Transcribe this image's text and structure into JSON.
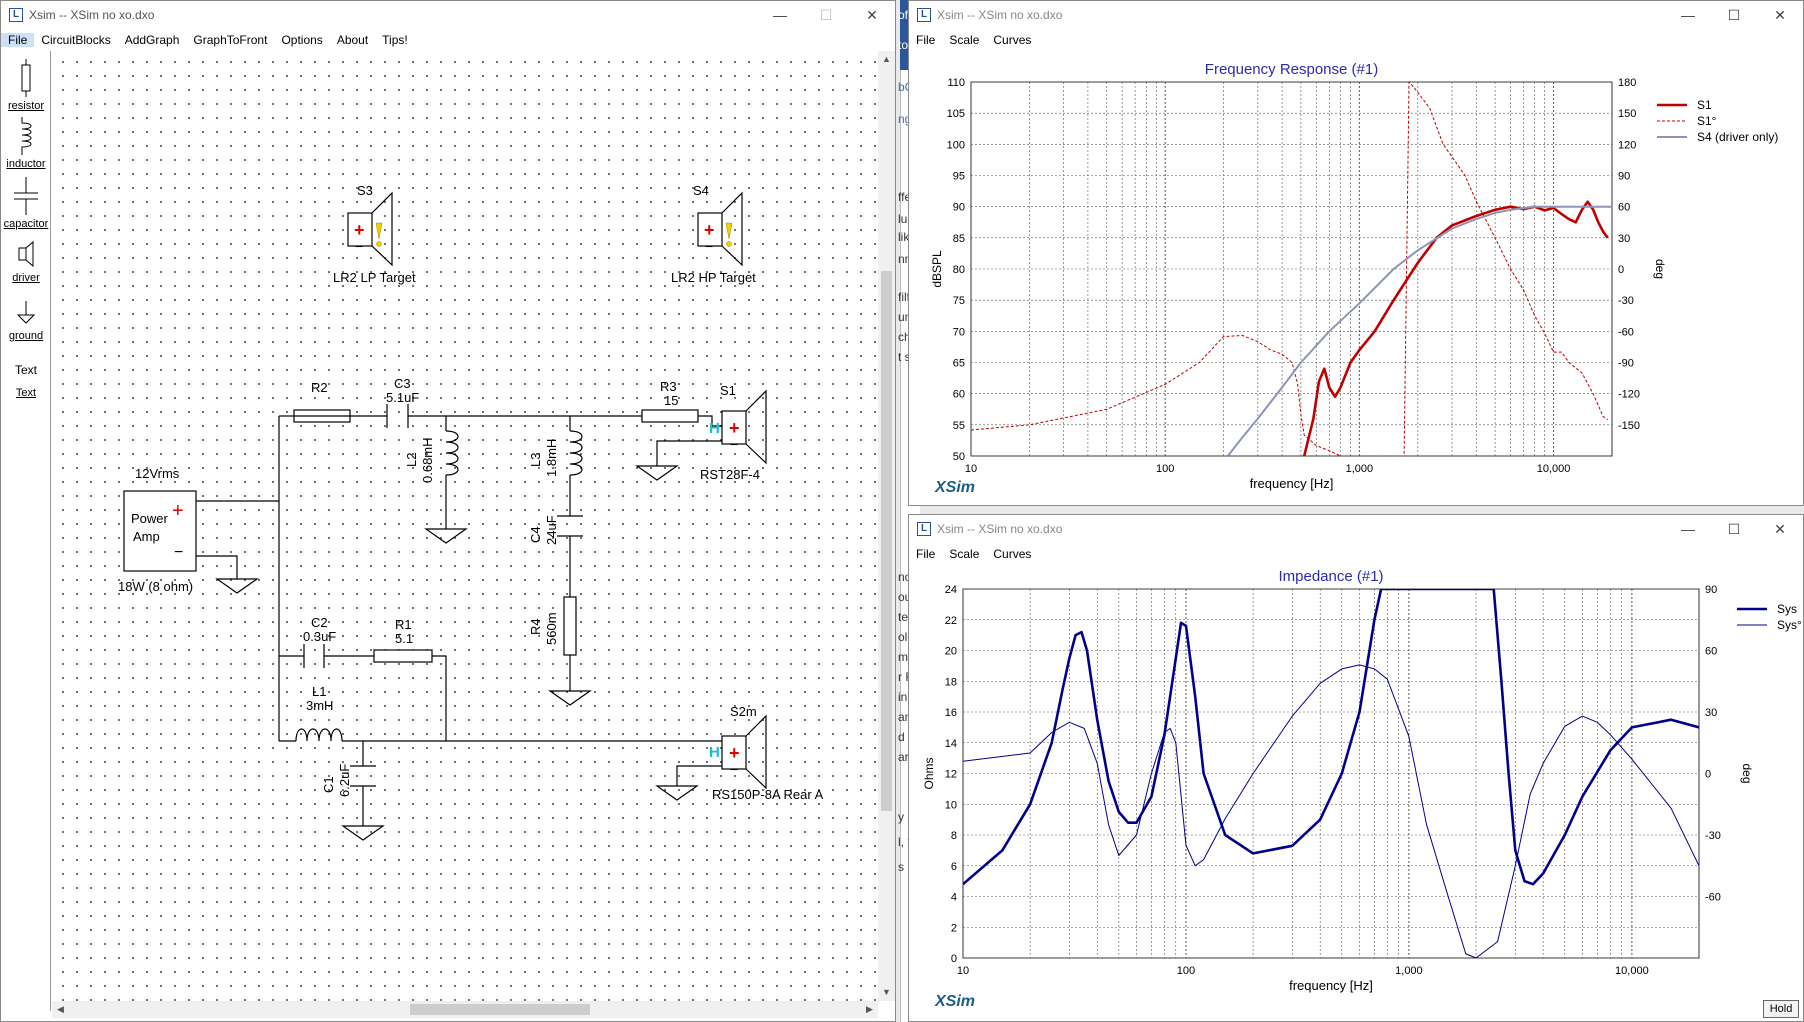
{
  "circuit_window": {
    "title": "Xsim -- XSim no xo.dxo",
    "menu": [
      "File",
      "CircuitBlocks",
      "AddGraph",
      "GraphToFront",
      "Options",
      "About",
      "Tips!"
    ],
    "toolbar": [
      {
        "label": "resistor",
        "icon": "resistor-icon"
      },
      {
        "label": "inductor",
        "icon": "inductor-icon"
      },
      {
        "label": "capacitor",
        "icon": "capacitor-icon"
      },
      {
        "label": "driver",
        "icon": "driver-icon"
      },
      {
        "label": "ground",
        "icon": "ground-icon"
      },
      {
        "label": "Text",
        "icon": "text-icon"
      },
      {
        "label": "Text",
        "icon": "text-label"
      }
    ],
    "components": {
      "s3_name": "S3",
      "s3_label": "LR2 LP Target",
      "s4_name": "S4",
      "s4_label": "LR2 HP Target",
      "r2_name": "R2",
      "c3_name": "C3",
      "c3_value": "5.1uF",
      "r3_name": "R3",
      "r3_value": "15",
      "s1_name": "S1",
      "s1_label": "RST28F-4",
      "l2_name": "L2",
      "l2_value": "0.68mH",
      "l3_name": "L3",
      "l3_value": "1.8mH",
      "c4_name": "C4",
      "c4_value": "24uF",
      "r4_name": "R4",
      "r4_value": "560m",
      "amp_voltage": "12Vrms",
      "amp_label_1": "Power",
      "amp_label_2": "Amp",
      "amp_power": "18W (8 ohm)",
      "c2_name": "C2",
      "c2_value": "0.3uF",
      "r1_name": "R1",
      "r1_value": "5.1",
      "l1_name": "L1",
      "l1_value": "3mH",
      "c1_name": "C1",
      "c1_value": "6.2uF",
      "s2m_name": "S2m",
      "s2m_label": "RS150P-8A Rear A",
      "plus": "+",
      "minus": "−"
    }
  },
  "freq_window": {
    "title": "Xsim -- XSim no xo.dxo",
    "menu": [
      "File",
      "Scale",
      "Curves"
    ],
    "brand": "XSim",
    "chart_data": {
      "type": "line",
      "title": "Frequency Response (#1)",
      "xlabel": "frequency [Hz]",
      "ylabel": "dBSPL",
      "y2label": "deg",
      "x_scale": "log",
      "xlim": [
        10,
        20000
      ],
      "ylim": [
        50,
        110
      ],
      "y2lim": [
        -180,
        180
      ],
      "x_ticks": [
        "10",
        "100",
        "1,000",
        "10,000"
      ],
      "y_ticks": [
        "110",
        "105",
        "100",
        "95",
        "90",
        "85",
        "80",
        "75",
        "70",
        "65",
        "60",
        "55",
        "50"
      ],
      "y2_ticks": [
        "180",
        "150",
        "120",
        "90",
        "60",
        "30",
        "0",
        "-30",
        "-60",
        "-90",
        "-120",
        "-150"
      ],
      "legend_position": "right",
      "series": [
        {
          "name": "S1",
          "axis": "left",
          "style": "solid-thick",
          "color": "#c00000",
          "x": [
            520,
            580,
            620,
            660,
            700,
            750,
            800,
            900,
            1000,
            1200,
            1500,
            2000,
            2500,
            3000,
            4000,
            5000,
            6000,
            7000,
            8000,
            9000,
            10000,
            11000,
            12000,
            13000,
            14000,
            15000,
            16000,
            17000,
            18000,
            19000
          ],
          "y": [
            50,
            56,
            62,
            64,
            61,
            59.5,
            61,
            65,
            67,
            70,
            75,
            81,
            85,
            87,
            88.5,
            89.5,
            90,
            89.6,
            90,
            89.4,
            89.8,
            88.8,
            88,
            87.5,
            89.5,
            90.8,
            89.5,
            87.5,
            86,
            85
          ]
        },
        {
          "name": "S1°",
          "axis": "right",
          "style": "dashed",
          "color": "#c00000",
          "x": [
            10,
            20,
            50,
            100,
            150,
            200,
            250,
            300,
            350,
            400,
            450,
            480,
            500,
            520,
            560,
            600,
            700,
            800,
            1000,
            1300,
            1700,
            1800,
            1800,
            1850,
            2000,
            2300,
            2700,
            3000,
            3500,
            4000,
            5000,
            6000,
            7000,
            8000,
            9000,
            10000,
            11000,
            12000,
            14000,
            16000,
            18000,
            19000
          ],
          "y": [
            -155,
            -150,
            -135,
            -111,
            -90,
            -65,
            -64,
            -70,
            -78,
            -82,
            -90,
            -110,
            -140,
            -160,
            -165,
            -170,
            -175,
            -180,
            -180,
            -180,
            -180,
            170,
            180,
            178,
            170,
            155,
            120,
            108,
            90,
            65,
            30,
            0,
            -20,
            -45,
            -62,
            -80,
            -80,
            -90,
            -100,
            -120,
            -142,
            -145
          ]
        },
        {
          "name": "S4 (driver only)",
          "axis": "left",
          "style": "solid",
          "color": "#8e93b8",
          "x": [
            210,
            250,
            300,
            400,
            500,
            700,
            1000,
            1500,
            2000,
            3000,
            4000,
            5000,
            6000,
            8000,
            10000,
            20000
          ],
          "y": [
            50,
            53,
            56,
            61,
            65,
            70,
            74.5,
            80,
            83,
            86.5,
            88,
            89,
            89.5,
            90,
            90,
            90
          ]
        }
      ]
    }
  },
  "imp_window": {
    "title": "Xsim -- XSim no xo.dxo",
    "menu": [
      "File",
      "Scale",
      "Curves"
    ],
    "brand": "XSim",
    "hold_label": "Hold",
    "chart_data": {
      "type": "line",
      "title": "Impedance (#1)",
      "xlabel": "frequency [Hz]",
      "ylabel": "Ohms",
      "y2label": "deg",
      "x_scale": "log",
      "xlim": [
        10,
        20000
      ],
      "ylim": [
        0,
        24
      ],
      "y2lim": [
        -90,
        90
      ],
      "x_ticks": [
        "10",
        "100",
        "1,000",
        "10,000"
      ],
      "y_ticks": [
        "24",
        "22",
        "20",
        "18",
        "16",
        "14",
        "12",
        "10",
        "8",
        "6",
        "4",
        "2",
        "0"
      ],
      "y2_ticks": [
        "90",
        "60",
        "30",
        "0",
        "-30",
        "-60"
      ],
      "legend_position": "right",
      "series": [
        {
          "name": "Sys",
          "axis": "left",
          "style": "solid-thick",
          "color": "#00008b",
          "x": [
            10,
            15,
            20,
            25,
            28,
            30,
            32,
            34,
            36,
            40,
            45,
            50,
            55,
            60,
            70,
            80,
            90,
            95,
            100,
            110,
            120,
            150,
            200,
            300,
            400,
            500,
            600,
            700,
            750,
            800,
            2400,
            2600,
            2800,
            3000,
            3300,
            3600,
            4000,
            5000,
            6000,
            8000,
            10000,
            15000,
            20000
          ],
          "y": [
            4.8,
            7,
            10,
            14,
            17.5,
            19.5,
            21,
            21.2,
            20,
            15.5,
            11.5,
            9.5,
            8.8,
            8.8,
            10.5,
            14.5,
            19.5,
            21.8,
            21.6,
            17,
            12,
            8,
            6.8,
            7.3,
            9,
            12,
            16,
            22,
            24,
            24,
            24,
            18,
            12,
            7,
            5,
            4.8,
            5.5,
            8,
            10.5,
            13.5,
            15,
            15.5,
            15
          ]
        },
        {
          "name": "Sys°",
          "axis": "right",
          "style": "thin",
          "color": "#00008b",
          "x": [
            10,
            20,
            25,
            30,
            35,
            40,
            45,
            50,
            60,
            70,
            80,
            85,
            90,
            100,
            110,
            120,
            150,
            200,
            300,
            400,
            500,
            600,
            700,
            800,
            1000,
            1200,
            1500,
            1800,
            2000,
            2500,
            3000,
            3500,
            4000,
            5000,
            6000,
            7000,
            8000,
            10000,
            15000,
            20000
          ],
          "y": [
            6,
            10,
            20,
            25,
            22,
            5,
            -25,
            -40,
            -30,
            0,
            20,
            22,
            15,
            -35,
            -45,
            -42,
            -22,
            0,
            28,
            44,
            51,
            53,
            51,
            46,
            18,
            -25,
            -60,
            -88,
            -90,
            -82,
            -45,
            -10,
            5,
            23,
            28,
            25,
            19,
            7,
            -17,
            -45
          ]
        }
      ]
    }
  },
  "background_fragments": [
    "oft",
    "to",
    "bC",
    "ng",
    "ffe",
    "luc",
    "lik",
    "nm",
    "filt",
    "un",
    "ch c",
    "t sc",
    "nod",
    "out",
    "ter",
    "ole",
    "me",
    "r Fs",
    "in",
    "ani",
    "d e",
    "ar",
    "y s",
    "l, t",
    "s h"
  ]
}
